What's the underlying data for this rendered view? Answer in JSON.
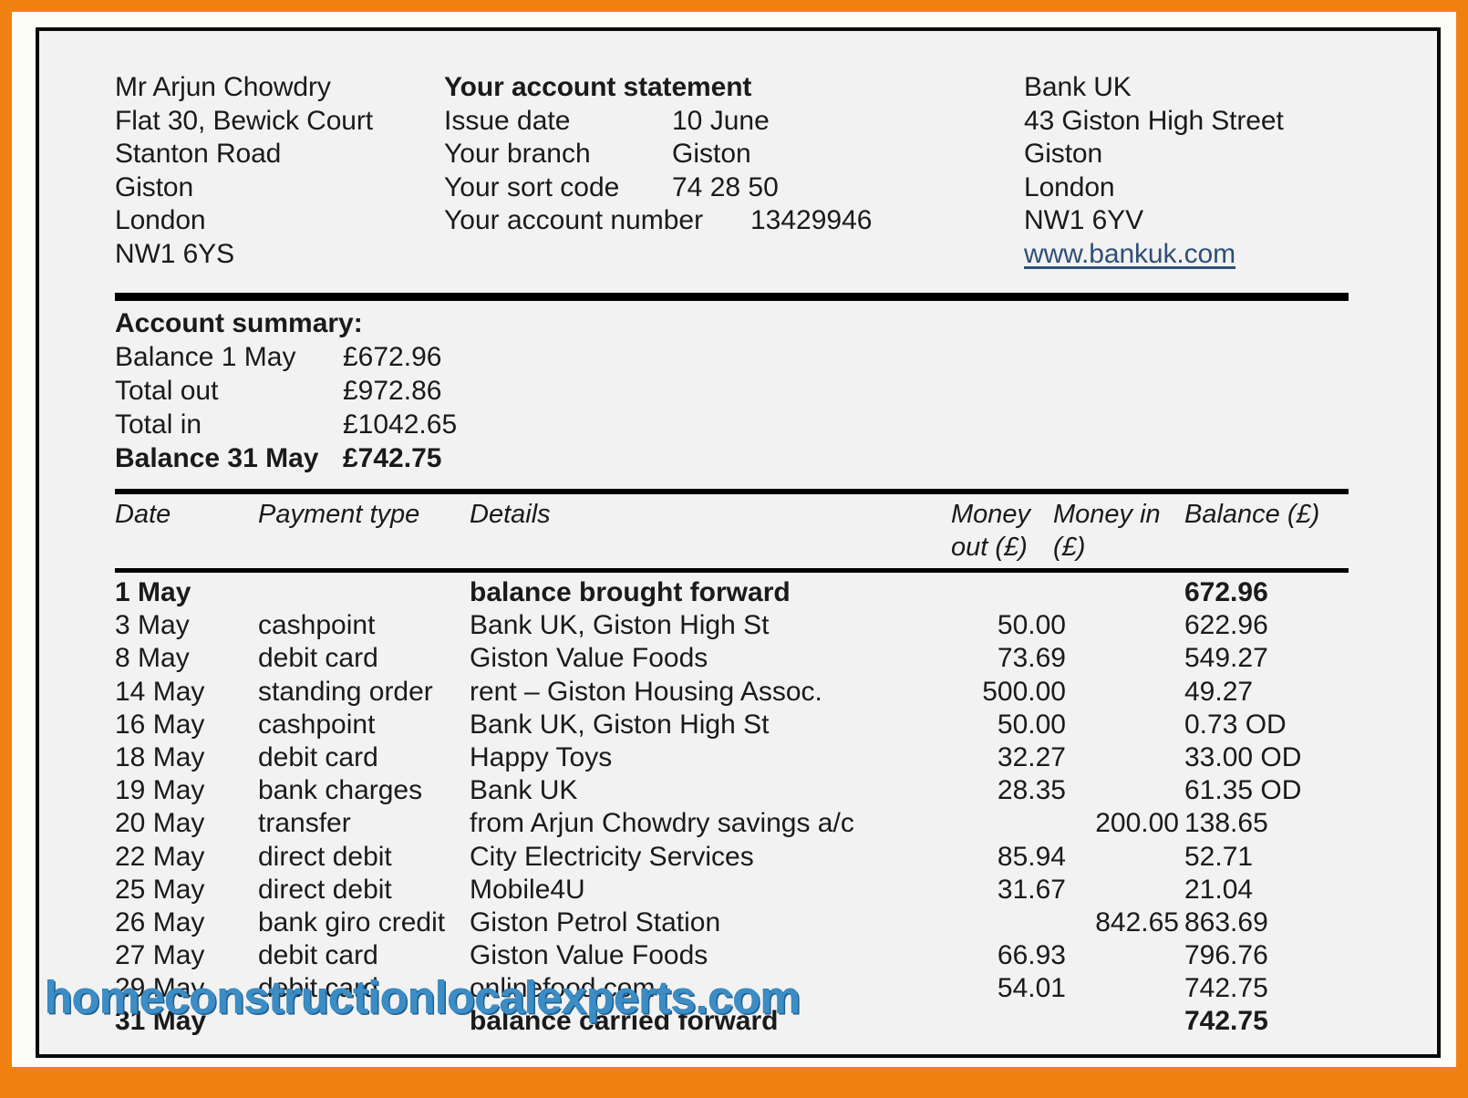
{
  "frame": {
    "border_color": "#f08010",
    "paper_color": "#f2f2f2",
    "rule_color": "#000000"
  },
  "customer": {
    "name": "Mr Arjun Chowdry",
    "address": [
      "Flat 30, Bewick Court",
      "Stanton Road",
      "Giston",
      "London",
      "NW1 6YS"
    ]
  },
  "statement": {
    "title": "Your account statement",
    "rows": [
      {
        "label": "Issue date",
        "value": "10 June"
      },
      {
        "label": "Your branch",
        "value": "Giston"
      },
      {
        "label": "Your sort code",
        "value": "74 28 50"
      },
      {
        "label": "Your account number",
        "value": "13429946"
      }
    ]
  },
  "bank": {
    "name": "Bank UK",
    "address": [
      "43 Giston High Street",
      "Giston",
      "London",
      "NW1 6YV"
    ],
    "website": "www.bankuk.com",
    "website_color": "#2f4f77"
  },
  "summary": {
    "title": "Account summary:",
    "rows": [
      {
        "label": "Balance 1 May",
        "amount": "£672.96",
        "bold": false
      },
      {
        "label": "Total out",
        "amount": "£972.86",
        "bold": false
      },
      {
        "label": "Total in",
        "amount": "£1042.65",
        "bold": false
      },
      {
        "label": "Balance 31 May",
        "amount": "£742.75",
        "bold": true
      }
    ]
  },
  "table": {
    "headers": {
      "date": "Date",
      "payment_type": "Payment type",
      "details": "Details",
      "money_out": "Money out (£)",
      "money_in": "Money in (£)",
      "balance": "Balance (£)"
    },
    "rows": [
      {
        "date": "1 May",
        "payment_type": "",
        "details": "balance brought forward",
        "money_out": "",
        "money_in": "",
        "balance": "672.96",
        "bold": true
      },
      {
        "date": "3 May",
        "payment_type": "cashpoint",
        "details": "Bank UK, Giston High St",
        "money_out": "50.00",
        "money_in": "",
        "balance": "622.96",
        "bold": false
      },
      {
        "date": "8 May",
        "payment_type": "debit card",
        "details": "Giston Value Foods",
        "money_out": "73.69",
        "money_in": "",
        "balance": "549.27",
        "bold": false
      },
      {
        "date": "14 May",
        "payment_type": "standing order",
        "details": "rent – Giston Housing Assoc.",
        "money_out": "500.00",
        "money_in": "",
        "balance": "49.27",
        "bold": false
      },
      {
        "date": "16 May",
        "payment_type": "cashpoint",
        "details": "Bank UK, Giston High St",
        "money_out": "50.00",
        "money_in": "",
        "balance": "0.73 OD",
        "bold": false
      },
      {
        "date": "18 May",
        "payment_type": "debit card",
        "details": "Happy Toys",
        "money_out": "32.27",
        "money_in": "",
        "balance": "33.00 OD",
        "bold": false
      },
      {
        "date": "19 May",
        "payment_type": "bank charges",
        "details": "Bank UK",
        "money_out": "28.35",
        "money_in": "",
        "balance": "61.35 OD",
        "bold": false
      },
      {
        "date": "20 May",
        "payment_type": "transfer",
        "details": "from Arjun Chowdry savings a/c",
        "money_out": "",
        "money_in": "200.00",
        "balance": "138.65",
        "bold": false
      },
      {
        "date": "22 May",
        "payment_type": "direct debit",
        "details": "City Electricity Services",
        "money_out": "85.94",
        "money_in": "",
        "balance": "52.71",
        "bold": false
      },
      {
        "date": "25 May",
        "payment_type": "direct debit",
        "details": "Mobile4U",
        "money_out": "31.67",
        "money_in": "",
        "balance": "21.04",
        "bold": false
      },
      {
        "date": "26 May",
        "payment_type": "bank giro credit",
        "details": "Giston Petrol Station",
        "money_out": "",
        "money_in": "842.65",
        "balance": "863.69",
        "bold": false
      },
      {
        "date": "27 May",
        "payment_type": "debit card",
        "details": "Giston Value Foods",
        "money_out": "66.93",
        "money_in": "",
        "balance": "796.76",
        "bold": false
      },
      {
        "date": "29 May",
        "payment_type": "debit card",
        "details": "onlinefood.com",
        "money_out": "54.01",
        "money_in": "",
        "balance": "742.75",
        "bold": false
      },
      {
        "date": "31 May",
        "payment_type": "",
        "details": "balance carried forward",
        "money_out": "",
        "money_in": "",
        "balance": "742.75",
        "bold": true
      }
    ]
  },
  "watermark": {
    "text": "homeconstructionlocalexperts.com",
    "color": "#3c8dc5"
  }
}
